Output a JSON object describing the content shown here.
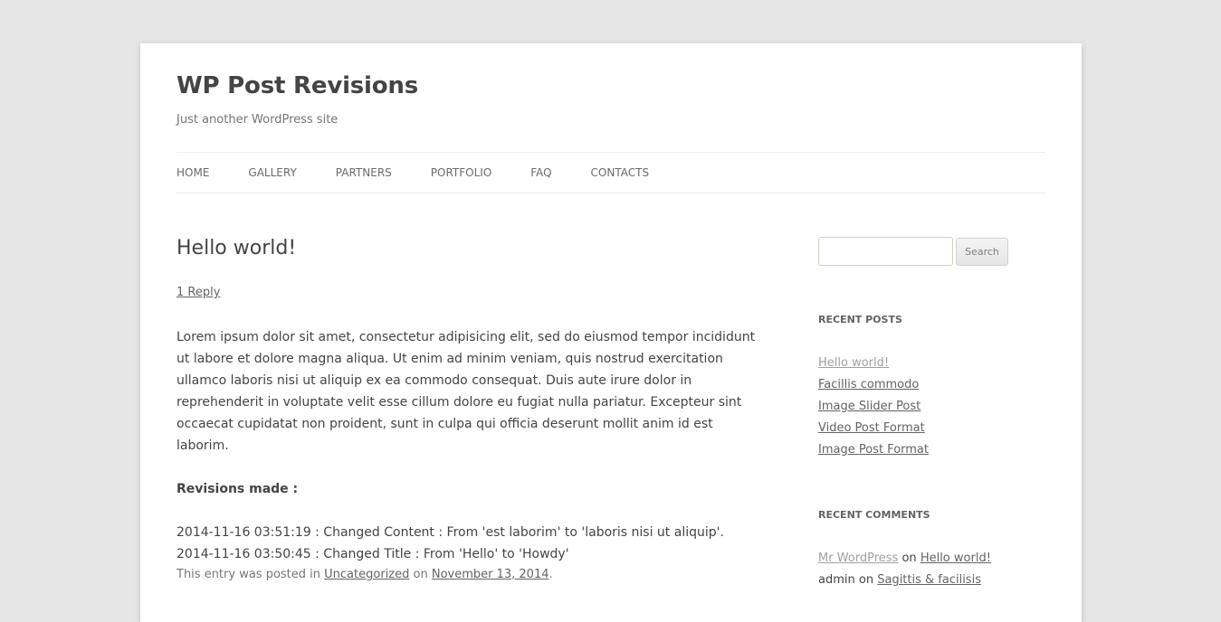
{
  "site": {
    "title": "WP Post Revisions",
    "description": "Just another WordPress site"
  },
  "nav": {
    "items": [
      "HOME",
      "GALLERY",
      "PARTNERS",
      "PORTFOLIO",
      "FAQ",
      "CONTACTS"
    ]
  },
  "post": {
    "title": "Hello world!",
    "reply_link": "1 Reply",
    "body": "Lorem ipsum dolor sit amet, consectetur adipisicing elit, sed do eiusmod tempor incididunt ut labore et dolore magna aliqua. Ut enim ad minim veniam, quis nostrud exercitation ullamco laboris nisi ut aliquip ex ea commodo consequat. Duis aute irure dolor in reprehenderit in voluptate velit esse cillum dolore eu fugiat nulla pariatur. Excepteur sint occaecat cupidatat non proident, sunt in culpa qui officia deserunt mollit anim id est laborim.",
    "revisions_heading": "Revisions made :",
    "revisions": [
      "2014-11-16 03:51:19 : Changed Content : From 'est laborim' to 'laboris nisi ut aliquip'.",
      "2014-11-16 03:50:45 : Changed Title : From 'Hello' to 'Howdy'"
    ],
    "meta": {
      "prefix": "This entry was posted in",
      "category": "Uncategorized",
      "on": "on",
      "date": "November 13, 2014",
      "suffix": "."
    }
  },
  "sidebar": {
    "search": {
      "placeholder": "",
      "button_label": "Search"
    },
    "recent_posts": {
      "title": "RECENT POSTS",
      "items": [
        "Hello world!",
        "Facillis commodo",
        "Image Slider Post",
        "Video Post Format",
        "Image Post Format"
      ]
    },
    "recent_comments": {
      "title": "RECENT COMMENTS",
      "items": [
        {
          "author": "Mr WordPress",
          "on": "on",
          "post": "Hello world!"
        },
        {
          "author": "admin",
          "on": "on",
          "post": "Sagittis & facilisis"
        }
      ]
    }
  },
  "colors": {
    "page_background": "#e6e6e6",
    "card_background": "#ffffff",
    "text": "#444444",
    "link": "#636363",
    "visited_link": "#9f9f9f"
  }
}
